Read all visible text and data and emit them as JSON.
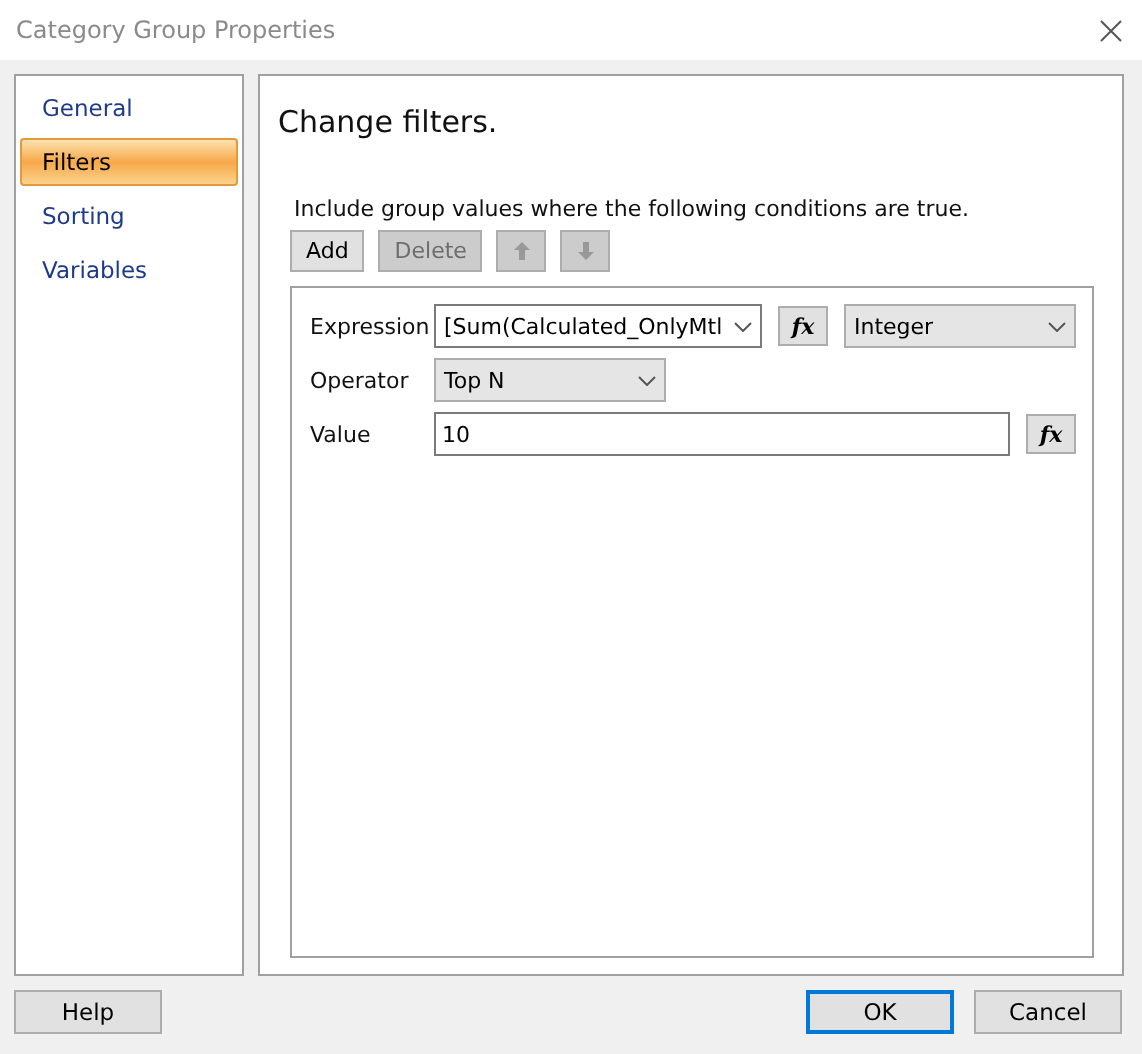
{
  "window": {
    "title": "Category Group Properties"
  },
  "sidebar": {
    "items": [
      {
        "label": "General",
        "selected": false
      },
      {
        "label": "Filters",
        "selected": true
      },
      {
        "label": "Sorting",
        "selected": false
      },
      {
        "label": "Variables",
        "selected": false
      }
    ]
  },
  "panel": {
    "heading": "Change filters.",
    "instruction": "Include group values where the following conditions are true.",
    "toolbar": [
      {
        "kind": "text",
        "label": "Add",
        "disabled": false
      },
      {
        "kind": "text",
        "label": "Delete",
        "disabled": true
      },
      {
        "kind": "up",
        "disabled": true
      },
      {
        "kind": "down",
        "disabled": true
      }
    ],
    "filter": {
      "expression_fx": "fx",
      "value_fx": "fx",
      "expression_label": "Expression",
      "expression": "[Sum(Calculated_OnlyMtl",
      "type": "Integer",
      "operator_label": "Operator",
      "operator": "Top N",
      "value_label": "Value",
      "value": "10"
    }
  },
  "buttons": [
    {
      "label": "Help",
      "default": false
    },
    {
      "label": "OK",
      "default": true
    },
    {
      "label": "Cancel",
      "default": false
    }
  ]
}
